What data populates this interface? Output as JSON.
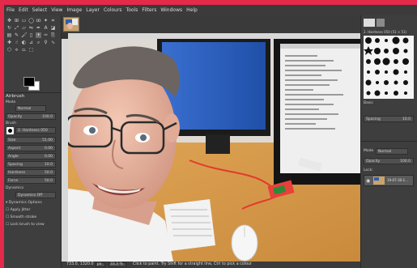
{
  "menubar": {
    "items": [
      "File",
      "Edit",
      "Select",
      "View",
      "Image",
      "Layer",
      "Colours",
      "Tools",
      "Filters",
      "Windows",
      "Help"
    ]
  },
  "tool_options": {
    "title": "Airbrush",
    "mode_label": "Mode",
    "mode_value": "Normal",
    "opacity_label": "Opacity",
    "opacity_value": "100.0",
    "brush_label": "Brush",
    "brush_value": "2. Hardness 050",
    "size_label": "Size",
    "size_value": "51.00",
    "aspect_label": "Aspect",
    "aspect_value": "0.00",
    "angle_label": "Angle",
    "angle_value": "0.00",
    "spacing_label": "Spacing",
    "spacing_value": "10.0",
    "hardness_label": "Hardness",
    "hardness_value": "50.0",
    "force_label": "Force",
    "force_value": "50.0",
    "dynamics_label": "Dynamics",
    "dynamics_value": "Dynamics Off",
    "dynamics_options": "Dynamics Options",
    "apply_jitter": "Apply Jitter",
    "smooth_stroke": "Smooth stroke",
    "lock_brush": "Lock brush to view"
  },
  "brushes": {
    "filter_label": "2. Hardness 050 (51 × 51)",
    "tag_label": "Basic",
    "spacing_label": "Spacing",
    "spacing_value": "10.0"
  },
  "layers": {
    "mode_label": "Mode",
    "mode_value": "Normal",
    "opacity_label": "Opacity",
    "opacity_value": "100.0",
    "lock_label": "Lock:",
    "layer_name": "19-07-30-1..."
  },
  "status": {
    "unit": "px",
    "zoom": "33.3 %",
    "coords": "733.0, 1320.0",
    "message": "Click to paint. Try Shift for a straight line, Ctrl to pick a colour"
  },
  "colors": {
    "frame": "#e5294a",
    "panel": "#3e3e3e",
    "foreground": "#000000",
    "background": "#ffffff"
  }
}
